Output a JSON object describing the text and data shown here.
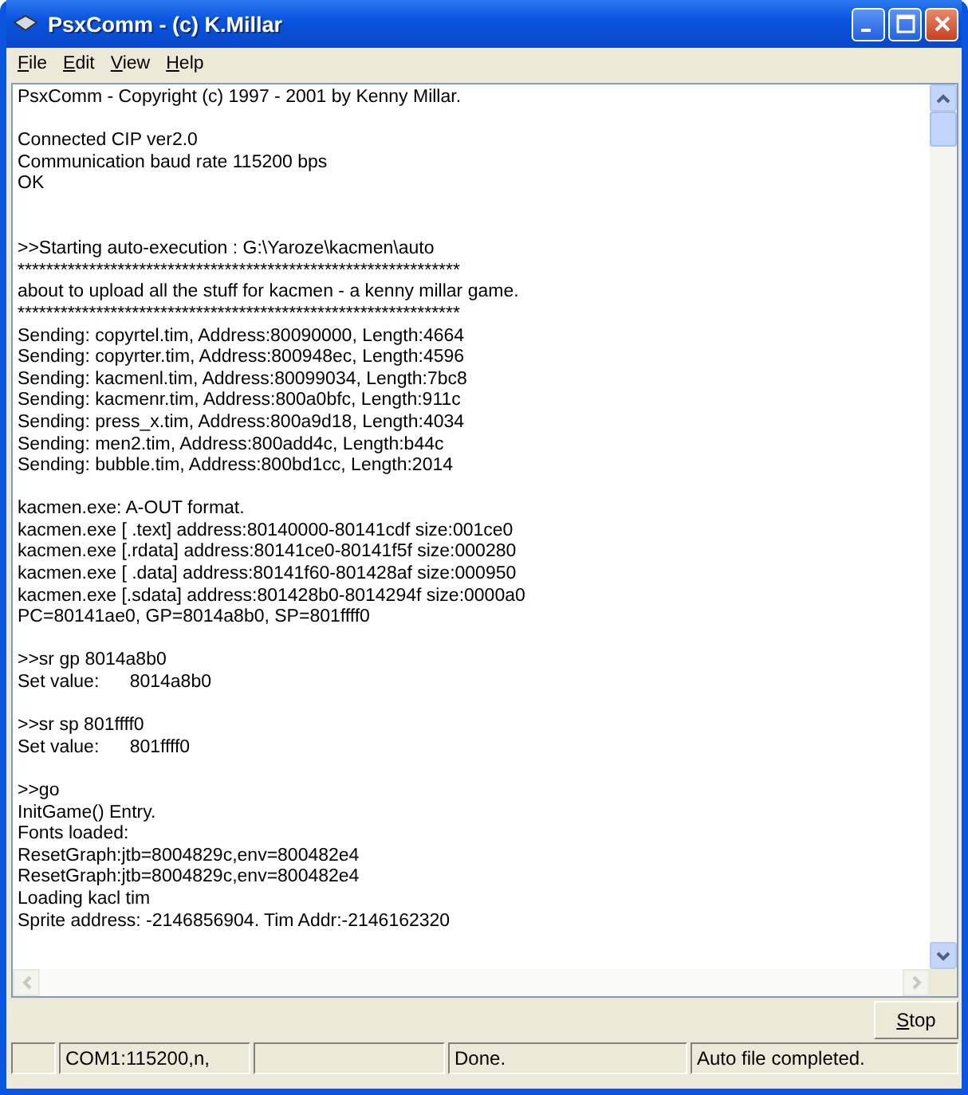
{
  "window": {
    "title": "PsxComm - (c) K.Millar"
  },
  "menu": [
    {
      "label": "File"
    },
    {
      "label": "Edit"
    },
    {
      "label": "View"
    },
    {
      "label": "Help"
    }
  ],
  "log": [
    {
      "kind": "text",
      "text": "PsxComm - Copyright (c) 1997 - 2001 by Kenny Millar."
    },
    {
      "kind": "blank"
    },
    {
      "kind": "text",
      "text": "Connected CIP ver2.0"
    },
    {
      "kind": "text",
      "text": "Communication baud rate 115200 bps"
    },
    {
      "kind": "text",
      "text": "OK"
    },
    {
      "kind": "blank"
    },
    {
      "kind": "blank"
    },
    {
      "kind": "text",
      "text": ">>Starting auto-execution : G:\\Yaroze\\kacmen\\auto"
    },
    {
      "kind": "text",
      "text": "**************************************************************"
    },
    {
      "kind": "text",
      "text": "about to upload all the stuff for kacmen - a kenny millar game."
    },
    {
      "kind": "text",
      "text": "**************************************************************"
    },
    {
      "kind": "text",
      "text": "Sending: copyrtel.tim, Address:80090000, Length:4664"
    },
    {
      "kind": "text",
      "text": "Sending: copyrter.tim, Address:800948ec, Length:4596"
    },
    {
      "kind": "text",
      "text": "Sending: kacmenl.tim, Address:80099034, Length:7bc8"
    },
    {
      "kind": "text",
      "text": "Sending: kacmenr.tim, Address:800a0bfc, Length:911c"
    },
    {
      "kind": "text",
      "text": "Sending: press_x.tim, Address:800a9d18, Length:4034"
    },
    {
      "kind": "text",
      "text": "Sending: men2.tim, Address:800add4c, Length:b44c"
    },
    {
      "kind": "text",
      "text": "Sending: bubble.tim, Address:800bd1cc, Length:2014"
    },
    {
      "kind": "blank"
    },
    {
      "kind": "text",
      "text": "kacmen.exe: A-OUT format."
    },
    {
      "kind": "text",
      "text": "kacmen.exe [ .text] address:80140000-80141cdf size:001ce0"
    },
    {
      "kind": "text",
      "text": "kacmen.exe [.rdata] address:80141ce0-80141f5f size:000280"
    },
    {
      "kind": "text",
      "text": "kacmen.exe [ .data] address:80141f60-801428af size:000950"
    },
    {
      "kind": "text",
      "text": "kacmen.exe [.sdata] address:801428b0-8014294f size:0000a0"
    },
    {
      "kind": "text",
      "text": "PC=80141ae0, GP=8014a8b0, SP=801ffff0"
    },
    {
      "kind": "blank"
    },
    {
      "kind": "text",
      "text": ">>sr gp 8014a8b0"
    },
    {
      "kind": "text",
      "text": "Set value:      8014a8b0"
    },
    {
      "kind": "blank"
    },
    {
      "kind": "text",
      "text": ">>sr sp 801ffff0"
    },
    {
      "kind": "text",
      "text": "Set value:      801ffff0"
    },
    {
      "kind": "blank"
    },
    {
      "kind": "text",
      "text": ">>go"
    },
    {
      "kind": "text",
      "text": "InitGame() Entry."
    },
    {
      "kind": "text",
      "text": "Fonts loaded:"
    },
    {
      "kind": "text",
      "text": "ResetGraph:jtb=8004829c,env=800482e4"
    },
    {
      "kind": "text",
      "text": "ResetGraph:jtb=8004829c,env=800482e4"
    },
    {
      "kind": "text",
      "text": "Loading kacl tim"
    },
    {
      "kind": "text",
      "text": "Sprite address: -2146856904. Tim Addr:-2146162320"
    }
  ],
  "stop_button": {
    "label": "Stop"
  },
  "status_bar": [
    {
      "kind": "empty"
    },
    {
      "kind": "text",
      "text": "COM1:115200,n,"
    },
    {
      "kind": "empty"
    },
    {
      "kind": "text",
      "text": "Done."
    },
    {
      "kind": "text",
      "text": "Auto file completed."
    }
  ]
}
